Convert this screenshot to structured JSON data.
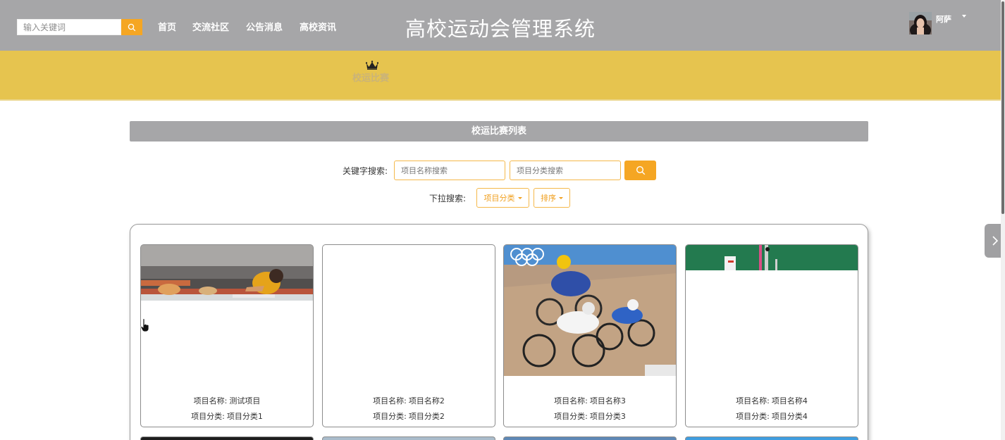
{
  "header": {
    "title": "高校运动会管理系统",
    "username": "阿萨"
  },
  "nav": {
    "search_placeholder": "输入关键词",
    "links": [
      "首页",
      "交流社区",
      "公告消息",
      "高校资讯",
      "校运比赛"
    ],
    "active_index": 4
  },
  "content": {
    "list_title": "校运比赛列表",
    "keyword_label": "关键字搜索:",
    "name_placeholder": "项目名称搜索",
    "category_placeholder": "项目分类搜索",
    "dropdown_label": "下拉搜索:",
    "category_dropdown": "项目分类",
    "sort_dropdown": "排序"
  },
  "cards": [
    {
      "name_key": "项目名称:",
      "name": "测试项目",
      "cat_key": "项目分类:",
      "cat": "项目分类1",
      "image": "hurdles-photo"
    },
    {
      "name_key": "项目名称:",
      "name": "项目名称2",
      "cat_key": "项目分类:",
      "cat": "项目分类2",
      "image": "blank"
    },
    {
      "name_key": "项目名称:",
      "name": "项目名称3",
      "cat_key": "项目分类:",
      "cat": "项目分类3",
      "image": "cycling-photo"
    },
    {
      "name_key": "项目名称:",
      "name": "项目名称4",
      "cat_key": "项目分类:",
      "cat": "项目分类4",
      "image": "stadium-photo"
    }
  ],
  "colors": {
    "header_bg": "#a6a6a8",
    "nav_bg": "#e6c44f",
    "accent": "#f5a623"
  },
  "icons": [
    "search-icon",
    "crown-icon",
    "chevron-right-icon",
    "caret-down-icon",
    "hand-cursor-icon"
  ]
}
